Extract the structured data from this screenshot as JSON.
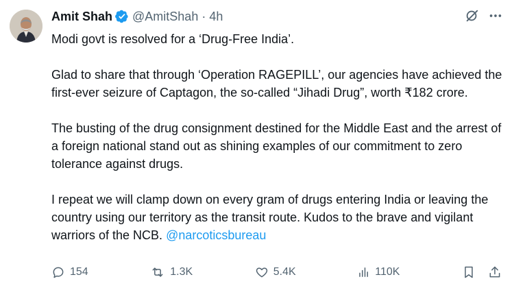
{
  "author": {
    "name": "Amit Shah",
    "handle": "@AmitShah",
    "separator": "·",
    "time": "4h",
    "verified_color": "#1d9bf0"
  },
  "tweet": {
    "paragraphs": [
      "Modi govt is resolved for a ‘Drug-Free India’.",
      "Glad to share that through ‘Operation RAGEPILL’, our agencies have achieved the first-ever seizure of Captagon, the so-called “Jihadi Drug”, worth ₹182 crore.",
      "The busting of the drug consignment destined for the Middle East and the arrest of a foreign national stand out as shining examples of our commitment to zero tolerance against drugs.",
      "I repeat we will clamp down on every gram of drugs entering India or leaving the country using our territory as the transit route. Kudos to the brave and vigilant warriors of the NCB."
    ],
    "mention": "@narcoticsbureau",
    "mention_color": "#1d9bf0"
  },
  "stats": {
    "replies": "154",
    "reposts": "1.3K",
    "likes": "5.4K",
    "views": "110K"
  },
  "icons": {
    "grok": "grok-icon",
    "more": "more-icon",
    "reply": "reply-icon",
    "repost": "repost-icon",
    "like": "like-icon",
    "views": "views-icon",
    "bookmark": "bookmark-icon",
    "share": "share-icon"
  }
}
